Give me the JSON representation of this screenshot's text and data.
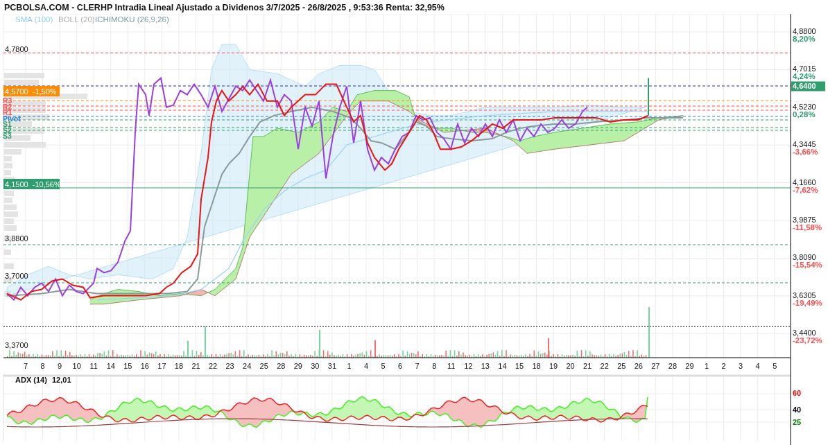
{
  "header": {
    "title": "PCBOLSA.COM - CLERHP Intradia Lineal Ajustado a Dividenos 3/7/2025 - 26/8/2025 , 9:53:36 Renta: 32,95%"
  },
  "legend": [
    {
      "label": "SMA (100)",
      "color": "#8ecdf5"
    },
    {
      "label": "BOLL (20)",
      "color": "#b0b0b0"
    },
    {
      "label": "ICHIMOKU (26,9,26)",
      "color": "#7a9e9e"
    }
  ],
  "price_chart": {
    "level_labels": [
      {
        "text": "4,7800"
      },
      {
        "text": "3,8800"
      },
      {
        "text": "3,7000"
      },
      {
        "text": "3,3700"
      }
    ],
    "markers": [
      {
        "text": "4,5700  -1,50%",
        "color": "#ff8c00"
      },
      {
        "text": "4,1500  -10,56%",
        "color": "#2e9e6e"
      }
    ],
    "pivots": [
      {
        "label": "R3",
        "color": "#ff4d4d"
      },
      {
        "label": "R2",
        "color": "#ff4d4d"
      },
      {
        "label": "R1",
        "color": "#ff4d4d"
      },
      {
        "label": "Pivot",
        "color": "#2a7fd4"
      },
      {
        "label": "S1",
        "color": "#2e9e6e"
      },
      {
        "label": "S2",
        "color": "#2e9e6e"
      },
      {
        "label": "S3",
        "color": "#2e9e6e"
      }
    ],
    "axis": [
      {
        "price": "4,8800",
        "change": "8,20%",
        "color": "#2e9e6e"
      },
      {
        "price": "4,7015",
        "change": "4,24%",
        "color": "#2e9e6e"
      },
      {
        "price": "4,5230",
        "change": "0,28%",
        "color": "#2e9e6e"
      },
      {
        "price": "4,3445",
        "change": "-3,66%",
        "color": "#ff4d4d"
      },
      {
        "price": "4,1660",
        "change": "-7,62%",
        "color": "#ff4d4d"
      },
      {
        "price": "3,9875",
        "change": "-11,58%",
        "color": "#ff4d4d"
      },
      {
        "price": "3,8090",
        "change": "-15,54%",
        "color": "#ff4d4d"
      },
      {
        "price": "3,6305",
        "change": "-19,49%",
        "color": "#ff4d4d"
      },
      {
        "price": "3,4400",
        "change": "-23,72%",
        "color": "#ff4d4d"
      }
    ],
    "last_price": "4,6400",
    "dates": [
      "7",
      "8",
      "9",
      "10",
      "11",
      "14",
      "15",
      "16",
      "17",
      "18",
      "21",
      "22",
      "23",
      "24",
      "25",
      "28",
      "29",
      "30",
      "31",
      "1",
      "4",
      "5",
      "6",
      "7",
      "8",
      "11",
      "12",
      "13",
      "14",
      "15",
      "18",
      "19",
      "20",
      "21",
      "22",
      "25",
      "26",
      "27",
      "28",
      "29",
      "1",
      "2",
      "3",
      "4",
      "5"
    ]
  },
  "adx": {
    "title": "ADX (14)",
    "value": "12,01",
    "levels": [
      {
        "text": "60",
        "color": "#ff0000"
      },
      {
        "text": "40",
        "color": "#000000"
      },
      {
        "text": "25",
        "color": "#008000"
      }
    ]
  }
}
